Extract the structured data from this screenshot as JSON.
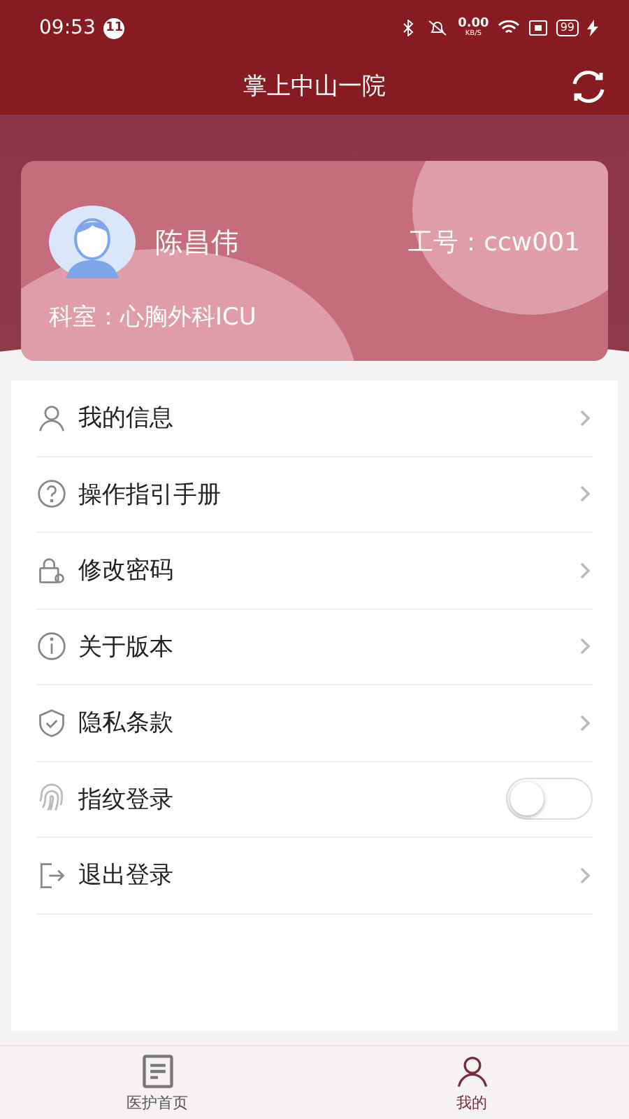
{
  "status_bar": {
    "time": "09:53",
    "notification_count": "11",
    "net_speed": "0.00",
    "net_unit": "KB/S",
    "battery": "99"
  },
  "header": {
    "title": "掌上中山一院"
  },
  "profile": {
    "name": "陈昌伟",
    "employee_id": "工号：ccw001",
    "department": "科室：心胸外科ICU"
  },
  "menu": [
    {
      "kind": "link",
      "label": "我的信息"
    },
    {
      "kind": "link",
      "label": "操作指引手册"
    },
    {
      "kind": "link",
      "label": "修改密码"
    },
    {
      "kind": "link",
      "label": "关于版本"
    },
    {
      "kind": "link",
      "label": "隐私条款"
    },
    {
      "kind": "toggle",
      "label": "指纹登录",
      "on": false
    },
    {
      "kind": "link",
      "label": "退出登录"
    }
  ],
  "tabs": [
    {
      "label": "医护首页",
      "selected": false
    },
    {
      "label": "我的",
      "selected": true
    }
  ]
}
